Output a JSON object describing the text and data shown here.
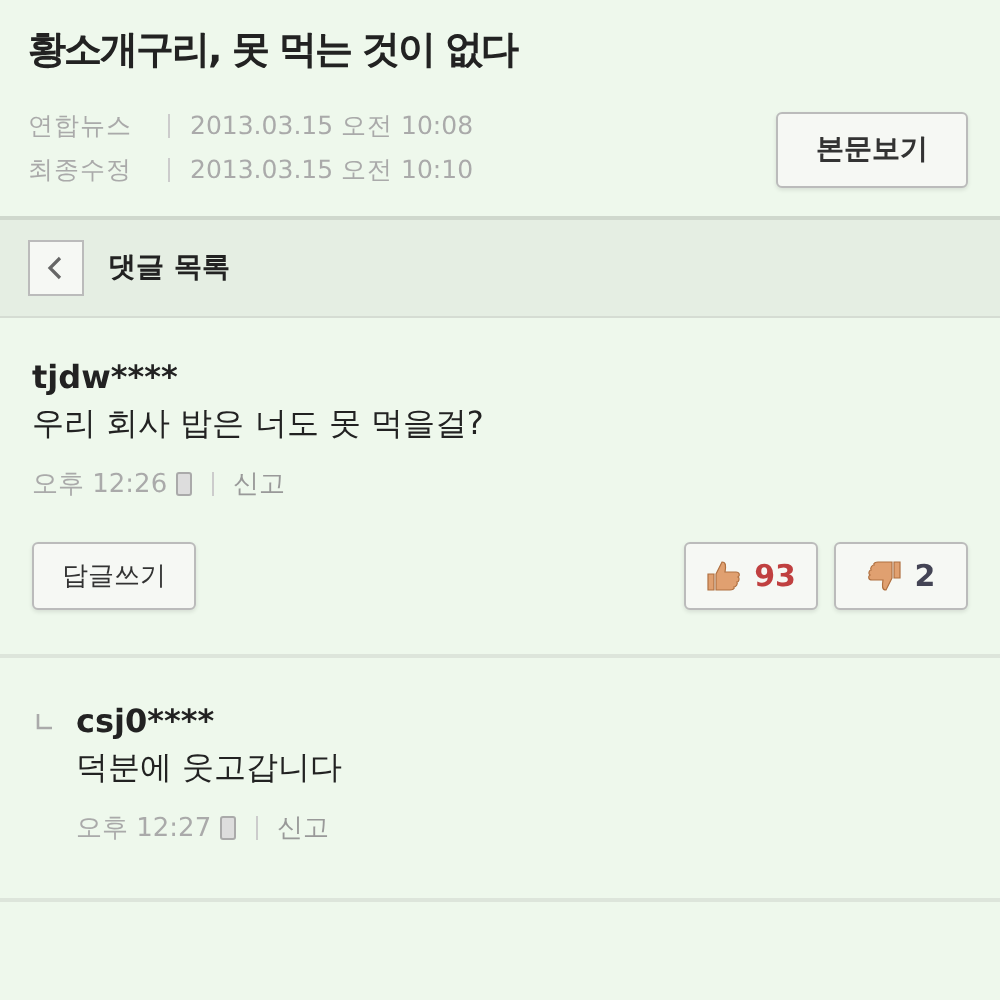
{
  "article": {
    "title": "황소개구리, 못 먹는 것이 없다",
    "meta": [
      {
        "label": "연합뉴스",
        "value": "2013.03.15 오전 10:08"
      },
      {
        "label": "최종수정",
        "value": "2013.03.15 오전 10:10"
      }
    ],
    "button": "본문보기"
  },
  "nav": {
    "title": "댓글 목록"
  },
  "comments": [
    {
      "kind": "comment",
      "user": "tjdw****",
      "text": "우리 회사 밥은 너도 못 먹을걸?",
      "time": "오후 12:26",
      "report": "신고",
      "reply_button": "답글쓰기",
      "likes": "93",
      "dislikes": "2"
    },
    {
      "kind": "reply",
      "user": "csj0****",
      "text": "덕분에 웃고갑니다",
      "time": "오후 12:27",
      "report": "신고"
    }
  ]
}
